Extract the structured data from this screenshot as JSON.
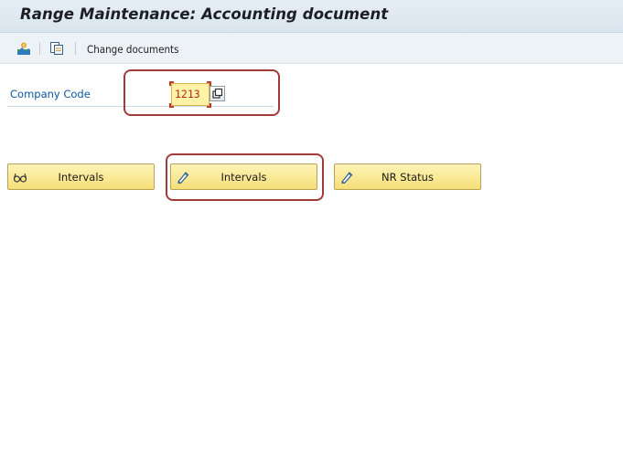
{
  "window": {
    "title": "Range Maintenance: Accounting document"
  },
  "toolbar": {
    "change_documents_label": "Change documents"
  },
  "form": {
    "company_code_label": "Company Code",
    "company_code_value": "1213"
  },
  "buttons": {
    "intervals_display_label": "Intervals",
    "intervals_change_label": "Intervals",
    "nr_status_label": "NR Status"
  },
  "icons": {
    "toolbar": [
      "person-landscape-icon",
      "copy-icon"
    ],
    "intervals_display": "glasses-icon",
    "intervals_change": "pencil-icon",
    "nr_status": "pencil-icon",
    "help": "overlapping-squares-icon"
  },
  "colors": {
    "highlight_border": "#a33a3a",
    "button_yellow": "#f6df79",
    "input_yellow": "#fff3a8",
    "label_blue": "#0b57a5"
  }
}
